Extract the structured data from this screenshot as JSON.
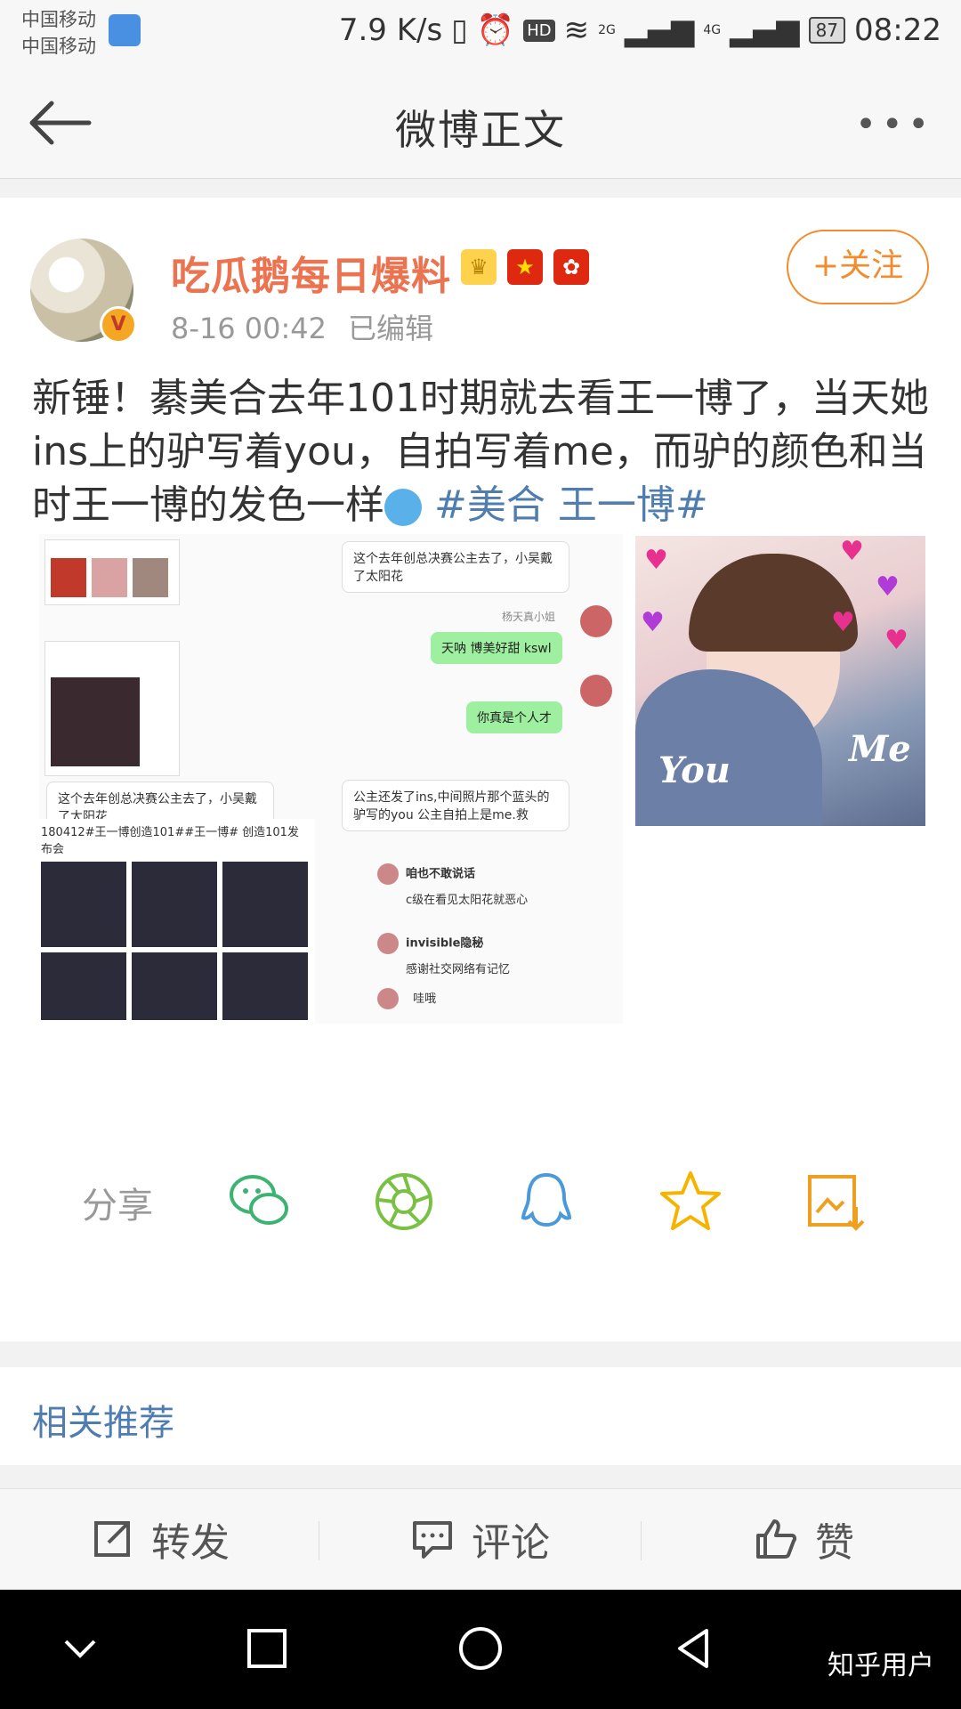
{
  "status_bar": {
    "carrier_1": "中国移动",
    "carrier_2": "中国移动",
    "network_speed": "7.9 K/s",
    "hd": "HD",
    "signal_1": "2G",
    "signal_2": "4G",
    "battery": "87",
    "time": "08:22"
  },
  "nav": {
    "title": "微博正文",
    "more": "•••"
  },
  "post": {
    "author": "吃瓜鹅每日爆料",
    "verified": "V",
    "time": "8-16 00:42",
    "edited": "已编辑",
    "follow_label": "+关注",
    "text": "新锤！綦美合去年101时期就去看王一博了，当天她ins上的驴写着you，自拍写着me，而驴的颜色和当时王一博的发色一样",
    "topic": "#美合 王一博#"
  },
  "images": {
    "chat_1": "这个去年创总决赛公主去了，小吴戴了太阳花",
    "chat_user": "杨天真小姐",
    "chat_2": "天呐 博美好甜 kswl",
    "chat_3": "你真是个人才",
    "chat_4": "这个去年创总决赛公主去了，小吴戴了太阳花",
    "chat_5": "公主还发了ins,中间照片那个蓝头的驴写的you 公主自拍上是me.救",
    "caption": "180412#王一博创造101##王一博# 创造101发布会",
    "comment_1_user": "咱也不敢说话",
    "comment_1_text": "c级在看见太阳花就恶心",
    "comment_2_user": "invisible隐秘",
    "comment_2_text": "感谢社交网络有记忆",
    "comment_3_text": "哇哦",
    "overlay_you": "You",
    "overlay_me": "Me"
  },
  "share": {
    "label": "分享"
  },
  "related": {
    "title": "相关推荐"
  },
  "actions": {
    "repost": "转发",
    "comment": "评论",
    "like": "赞"
  },
  "watermark": "知乎用户",
  "colors": {
    "username": "#eb7350",
    "follow": "#f28c2c",
    "topic": "#507daf"
  }
}
